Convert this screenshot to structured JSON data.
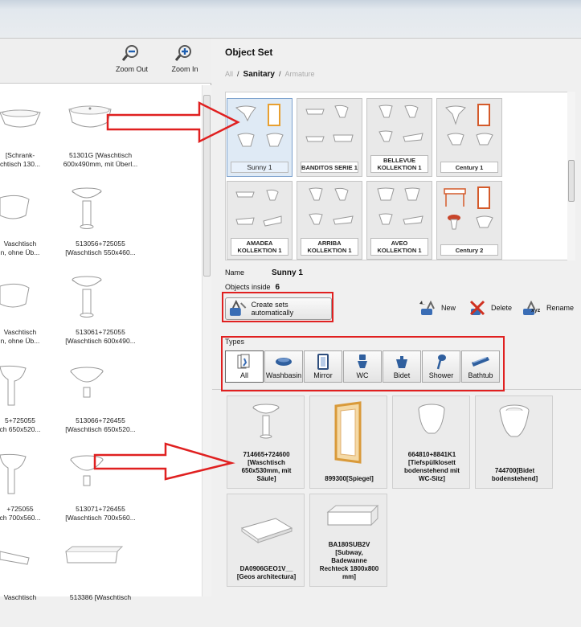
{
  "left_panel": {
    "zoom_out_label": "Zoom Out",
    "zoom_in_label": "Zoom In",
    "items": [
      {
        "caption": "[Schrank-\nchtisch 130..."
      },
      {
        "caption": "51301G [Waschtisch\n600x490mm, mit Überl..."
      },
      {
        "caption": "Vaschtisch\nn, ohne Üb..."
      },
      {
        "caption": "513056+725055\n[Waschtisch 550x460..."
      },
      {
        "caption": "Vaschtisch\nn, ohne Üb..."
      },
      {
        "caption": "513061+725055\n[Waschtisch 600x490..."
      },
      {
        "caption": "5+725055\nch 650x520..."
      },
      {
        "caption": "513066+726455\n[Waschtisch 650x520..."
      },
      {
        "caption": "+725055\nch 700x560..."
      },
      {
        "caption": "513071+726455\n[Waschtisch 700x560..."
      },
      {
        "caption": "Vaschtisch"
      },
      {
        "caption": "513386 [Waschtisch"
      }
    ]
  },
  "object_set": {
    "title": "Object Set",
    "breadcrumb": {
      "all": "All",
      "current": "Sanitary",
      "next": "Armature"
    },
    "sets": [
      {
        "label": "Sunny 1",
        "selected": true
      },
      {
        "label": "BANDITOS SERIE 1"
      },
      {
        "label": "BELLEVUE KOLLEKTION 1"
      },
      {
        "label": "Century 1"
      },
      {
        "label": "AMADEA KOLLEKTION 1"
      },
      {
        "label": "ARRIBA KOLLEKTION 1"
      },
      {
        "label": "AVEO KOLLEKTION 1"
      },
      {
        "label": "Century 2"
      }
    ],
    "name_label": "Name",
    "name_value": "Sunny 1",
    "objects_inside_label": "Objects inside",
    "objects_inside_value": "6",
    "create_button": "Create sets automatically",
    "new_button": "New",
    "delete_button": "Delete",
    "rename_button": "Rename",
    "types_label": "Types",
    "types": [
      "All",
      "Washbasin",
      "Mirror",
      "WC",
      "Bidet",
      "Shower",
      "Bathtub"
    ],
    "objects": [
      {
        "label": "714665+724600\n[Waschtisch\n650x530mm, mit\nSäule]"
      },
      {
        "label": "899300[Spiegel]"
      },
      {
        "label": "664810+8841K1\n[Tiefspülklosett\nbodenstehend mit\nWC-Sitz]"
      },
      {
        "label": "744700[Bidet\nbodenstehend]"
      },
      {
        "label": "DA0906GEO1V__\n[Geos architectura]"
      },
      {
        "label": "BA180SUB2V\n[Subway,\nBadewanne\nRechteck 1800x800\nmm]"
      }
    ]
  },
  "colors": {
    "annotation_red": "#e02020",
    "selection_blue": "#7da2ce",
    "mirror_frame": "#e8a030"
  }
}
